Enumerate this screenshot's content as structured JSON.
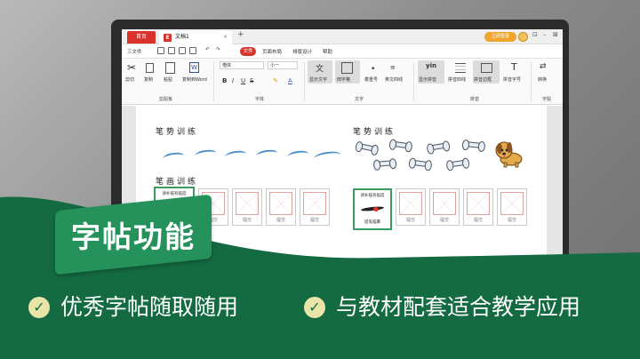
{
  "browser": {
    "home_tab": "首页",
    "doc_tab": "文档1",
    "doc_logo": "E",
    "add_tab": "+",
    "close_tab": "×",
    "login": "立即登录"
  },
  "menu": {
    "file_menu": "三文件",
    "file_button": "文件",
    "items": [
      "页面布局",
      "排版设计",
      "帮助"
    ]
  },
  "ribbon": {
    "clipboard": {
      "cut": "剪切",
      "copy": "复制",
      "paste": "粘贴",
      "copy_word": "复制到Word",
      "label": "剪贴板"
    },
    "font": {
      "family": "楷体",
      "size": "小一",
      "label": "字体"
    },
    "text": {
      "show_text": "显示文字",
      "grid": "田字格",
      "stack": "着重号",
      "english": "英文四线",
      "label": "文字"
    },
    "pinyin": {
      "yin": "yin",
      "show": "显示拼音",
      "four_line": "拼音四线",
      "border": "拼音边框",
      "font": "拼音字号",
      "label": "拼音"
    },
    "copybook": {
      "convert": "转换",
      "label": "字贴"
    }
  },
  "document": {
    "heading_strokes_left": "笔势训练",
    "heading_strokes_right": "笔势训练",
    "heading_draw": "笔画训练",
    "cell_hint": "请补临有临度",
    "cell_caption": "提交",
    "green_hint": "请补临有临度",
    "green_caption": "提笔临摹"
  },
  "promo": {
    "badge": "字帖功能",
    "feature_1": "优秀字帖随取随用",
    "feature_2": "与教材配套适合教学应用"
  },
  "colors": {
    "accent_red": "#d8322b",
    "green": "#146a41",
    "badge_green": "#24925a",
    "check_yellow": "#e9e4a8"
  }
}
